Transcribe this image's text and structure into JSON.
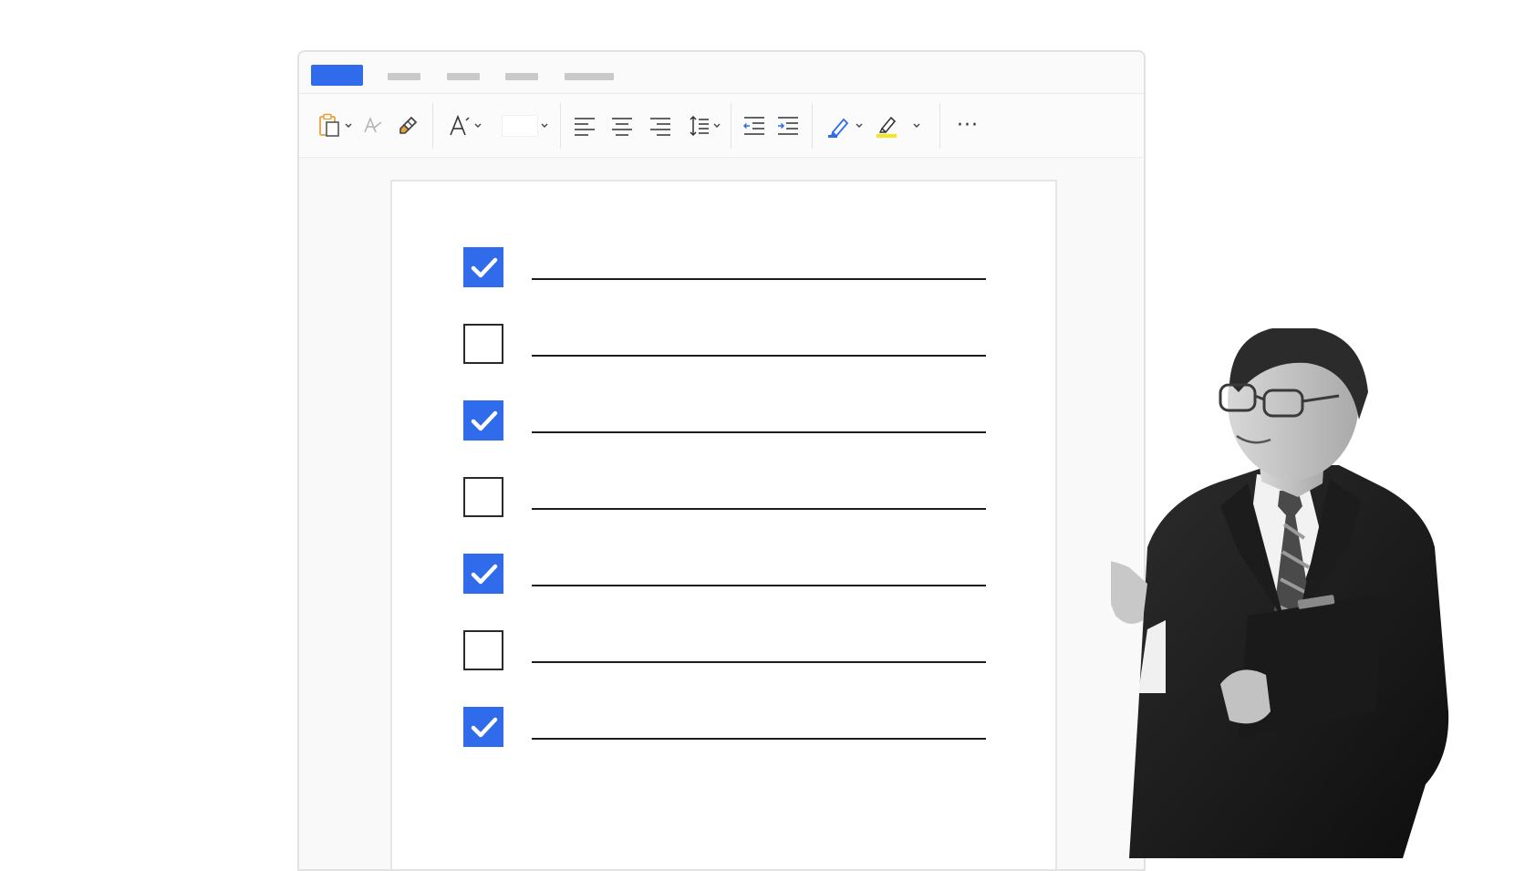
{
  "tabs": [
    {
      "state": "active"
    },
    {
      "state": "inactive"
    },
    {
      "state": "inactive"
    },
    {
      "state": "inactive"
    },
    {
      "state": "inactive"
    }
  ],
  "toolbar": {
    "icons": [
      "paste-icon",
      "clear-formatting-icon",
      "format-painter-icon",
      "font-size-icon",
      "font-size-field",
      "align-left-icon",
      "align-center-icon",
      "align-right-icon",
      "line-spacing-icon",
      "decrease-indent-icon",
      "increase-indent-icon",
      "pen-color-icon",
      "highlighter-icon",
      "more-icon"
    ],
    "more_label": "···"
  },
  "colors": {
    "accent": "#2f6bea",
    "highlight": "#f5e625",
    "paste_orange": "#e8a23b"
  },
  "checklist": [
    {
      "checked": true
    },
    {
      "checked": false
    },
    {
      "checked": true
    },
    {
      "checked": false
    },
    {
      "checked": true
    },
    {
      "checked": false
    },
    {
      "checked": true
    }
  ]
}
